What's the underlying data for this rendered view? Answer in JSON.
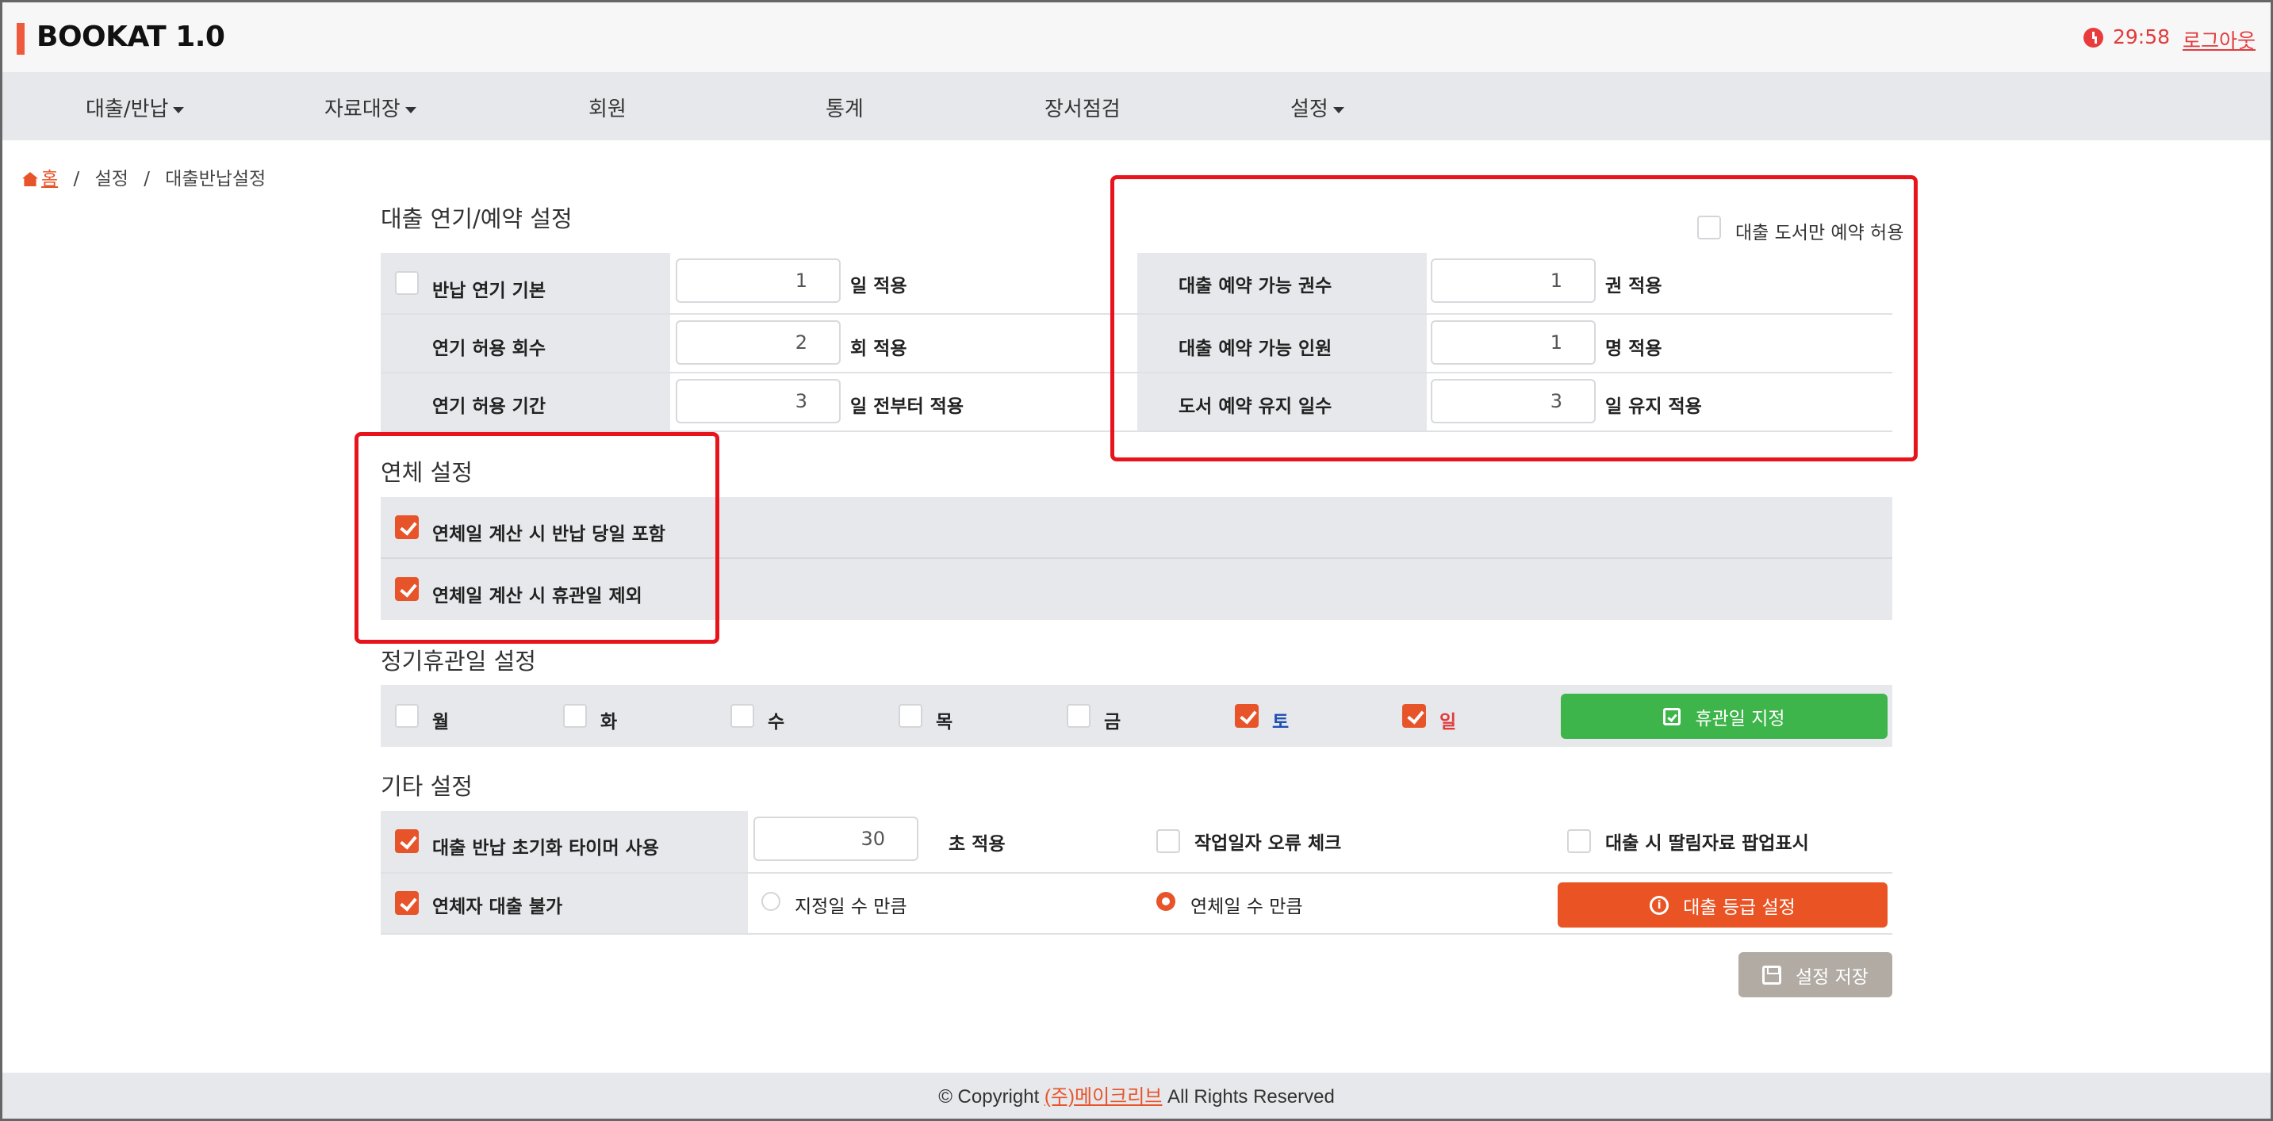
{
  "header": {
    "app_title": "BOOKAT 1.0",
    "timer": "29:58",
    "logout": "로그아웃"
  },
  "nav": {
    "items": [
      {
        "label": "대출/반납",
        "has_dropdown": true
      },
      {
        "label": "자료대장",
        "has_dropdown": true
      },
      {
        "label": "회원",
        "has_dropdown": false
      },
      {
        "label": "통계",
        "has_dropdown": false
      },
      {
        "label": "장서점검",
        "has_dropdown": false
      },
      {
        "label": "설정",
        "has_dropdown": true
      }
    ]
  },
  "breadcrumb": {
    "home": "홈",
    "separator": "/",
    "level1": "설정",
    "level2": "대출반납설정"
  },
  "loan_extension": {
    "title": "대출 연기/예약 설정",
    "rows": [
      {
        "checkbox": false,
        "label": "반납 연기 기본",
        "value": "1",
        "suffix": "일 적용"
      },
      {
        "label": "연기 허용 회수",
        "value": "2",
        "suffix": "회 적용"
      },
      {
        "label": "연기 허용 기간",
        "value": "3",
        "suffix": "일 전부터 적용"
      }
    ],
    "reserve_only_loaned": {
      "checked": false,
      "label": "대출 도서만 예약 허용"
    },
    "reserve_rows": [
      {
        "label": "대출 예약 가능 권수",
        "value": "1",
        "suffix": "권 적용"
      },
      {
        "label": "대출 예약 가능 인원",
        "value": "1",
        "suffix": "명 적용"
      },
      {
        "label": "도서 예약 유지 일수",
        "value": "3",
        "suffix": "일 유지 적용"
      }
    ]
  },
  "overdue": {
    "title": "연체 설정",
    "options": [
      {
        "checked": true,
        "label": "연체일 계산 시 반납 당일 포함"
      },
      {
        "checked": true,
        "label": "연체일 계산 시 휴관일 제외"
      }
    ]
  },
  "holidays": {
    "title": "정기휴관일 설정",
    "days": [
      {
        "label": "월",
        "checked": false
      },
      {
        "label": "화",
        "checked": false
      },
      {
        "label": "수",
        "checked": false
      },
      {
        "label": "목",
        "checked": false
      },
      {
        "label": "금",
        "checked": false
      },
      {
        "label": "토",
        "checked": true
      },
      {
        "label": "일",
        "checked": true
      }
    ],
    "button": "휴관일 지정"
  },
  "etc": {
    "title": "기타 설정",
    "timer_reset": {
      "checked": true,
      "label": "대출 반납 초기화 타이머 사용",
      "value": "30",
      "suffix": "초 적용"
    },
    "workdate_check": {
      "checked": false,
      "label": "작업일자 오류 체크"
    },
    "popup_attached": {
      "checked": false,
      "label": "대출 시 딸림자료 팝업표시"
    },
    "overdue_block": {
      "checked": true,
      "label": "연체자 대출 불가"
    },
    "radio_days": {
      "checked": false,
      "label": "지정일 수 만큼"
    },
    "radio_overdue": {
      "checked": true,
      "label": "연체일 수 만큼"
    },
    "grade_button": "대출 등급 설정"
  },
  "save_button": "설정 저장",
  "footer": {
    "prefix": "© Copyright ",
    "company": "(주)메이크리브",
    "suffix": " All Rights Reserved"
  },
  "colors": {
    "accent": "#e8542a",
    "green": "#3db54a",
    "highlight_box": "#e8141b",
    "sunday": "#e23b3b"
  }
}
